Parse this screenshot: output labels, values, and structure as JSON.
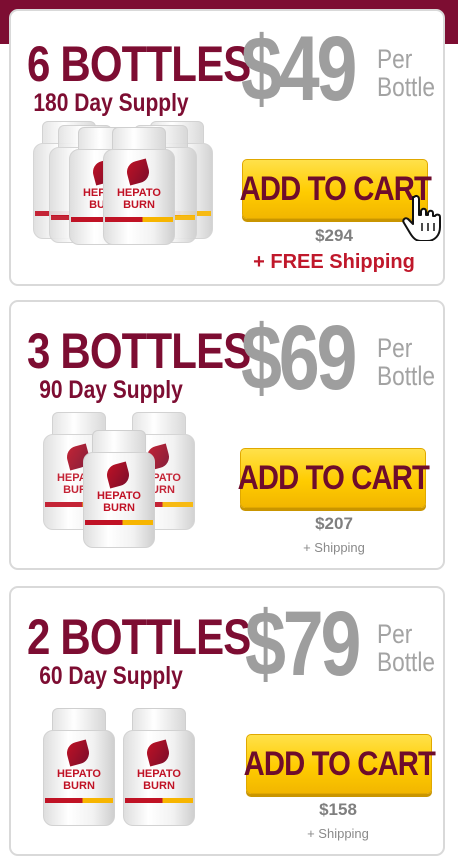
{
  "offers": [
    {
      "quantity": "6 BOTTLES",
      "supply": "180 Day Supply",
      "price": "$49",
      "per_line1": "Per",
      "per_line2": "Bottle",
      "cta": "ADD TO CART",
      "total": "$294",
      "shipping": "+ FREE Shipping"
    },
    {
      "quantity": "3 BOTTLES",
      "supply": "90 Day Supply",
      "price": "$69",
      "per_line1": "Per",
      "per_line2": "Bottle",
      "cta": "ADD TO CART",
      "total": "$207",
      "shipping": "+ Shipping"
    },
    {
      "quantity": "2 BOTTLES",
      "supply": "60 Day Supply",
      "price": "$79",
      "per_line1": "Per",
      "per_line2": "Bottle",
      "cta": "ADD TO CART",
      "total": "$158",
      "shipping": "+ Shipping"
    }
  ],
  "product": {
    "brand_line1": "HEPATO",
    "brand_line2": "BURN"
  },
  "colors": {
    "brand": "#7d0d32",
    "price_gray": "#9e9e9e",
    "button": "#ffcc00",
    "free_shipping": "#c0182b"
  },
  "icons": {
    "cursor": "pointing-hand-cursor-icon"
  }
}
